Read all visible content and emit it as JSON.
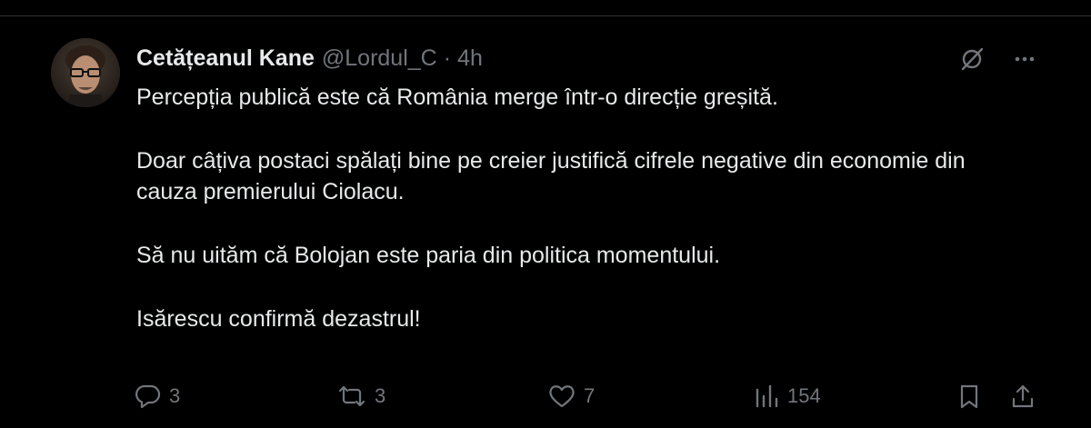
{
  "tweet": {
    "display_name": "Cetățeanul Kane",
    "handle": "@Lordul_C",
    "separator": "·",
    "time": "4h",
    "paragraphs": [
      "Percepția publică este că România merge într-o direcție greșită.",
      "Doar câțiva postaci spălați bine pe creier justifică cifrele negative din economie din cauza premierului Ciolacu.",
      "Să nu uităm că Bolojan este paria din politica momentului.",
      "Isărescu confirmă dezastrul!"
    ],
    "actions": {
      "replies": "3",
      "reposts": "3",
      "likes": "7",
      "views": "154"
    }
  },
  "icons": {
    "top": [
      "grok-slash-icon",
      "more-icon"
    ],
    "actions": [
      "reply-icon",
      "repost-icon",
      "like-icon",
      "views-icon",
      "bookmark-icon",
      "share-icon"
    ]
  },
  "colors": {
    "background": "#000000",
    "text": "#e7e9ea",
    "secondary": "#71767b",
    "divider": "#2f3336"
  }
}
